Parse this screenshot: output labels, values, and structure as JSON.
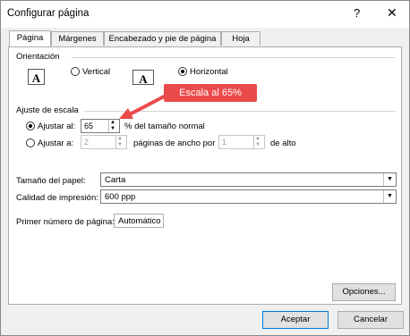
{
  "window": {
    "title": "Configurar página",
    "help_icon": "?",
    "close_icon": "✕"
  },
  "tabs": [
    "Página",
    "Márgenes",
    "Encabezado y pie de página",
    "Hoja"
  ],
  "orientation": {
    "legend": "Orientación",
    "vertical_label": "Vertical",
    "horizontal_label": "Horizontal",
    "selected": "Horizontal",
    "portrait_glyph": "A",
    "landscape_glyph": "A"
  },
  "scaling": {
    "legend": "Ajuste de escala",
    "adjust_to_label": "Ajustar al:",
    "adjust_to_value": "65",
    "adjust_to_suffix": "% del tamaño normal",
    "fit_to_label": "Ajustar a:",
    "fit_wide_value": "2",
    "fit_wide_suffix": "páginas de ancho por",
    "fit_tall_value": "1",
    "fit_tall_suffix": "de alto",
    "selected": "Ajustar al:"
  },
  "annotation": {
    "callout_text": "Escala al 65%",
    "color": "#ea4a4a"
  },
  "paper": {
    "size_label": "Tamaño del papel:",
    "size_value": "Carta",
    "quality_label": "Calidad de impresión:",
    "quality_value": "600 ppp"
  },
  "first_page": {
    "label": "Primer número de página:",
    "value": "Automático"
  },
  "buttons": {
    "options": "Opciones...",
    "accept": "Aceptar",
    "cancel": "Cancelar"
  }
}
